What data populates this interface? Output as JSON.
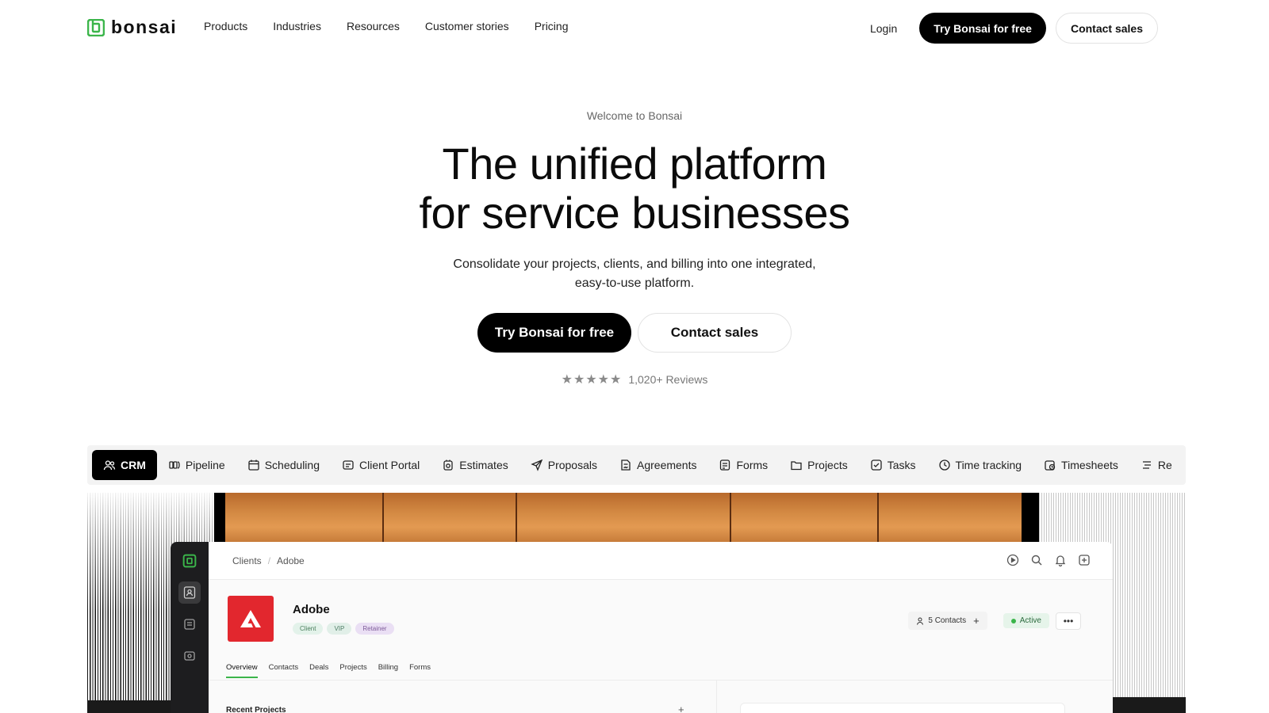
{
  "brand": {
    "name": "bonsai",
    "accent": "#3bb54a"
  },
  "nav": {
    "links": [
      "Products",
      "Industries",
      "Resources",
      "Customer stories",
      "Pricing"
    ],
    "login": "Login",
    "try_free": "Try Bonsai for free",
    "contact_sales": "Contact sales"
  },
  "hero": {
    "eyebrow": "Welcome to Bonsai",
    "headline_line1": "The unified platform",
    "headline_line2": "for service businesses",
    "subhead": "Consolidate your projects, clients, and billing into one integrated, easy-to-use platform.",
    "cta_primary": "Try Bonsai for free",
    "cta_secondary": "Contact sales",
    "stars": "★★★★★",
    "reviews": "1,020+ Reviews"
  },
  "feature_tabs": {
    "items": [
      {
        "label": "CRM",
        "icon": "users-icon",
        "active": true
      },
      {
        "label": "Pipeline",
        "icon": "pipeline-icon"
      },
      {
        "label": "Scheduling",
        "icon": "calendar-icon"
      },
      {
        "label": "Client Portal",
        "icon": "portal-icon"
      },
      {
        "label": "Estimates",
        "icon": "estimate-icon"
      },
      {
        "label": "Proposals",
        "icon": "send-icon"
      },
      {
        "label": "Agreements",
        "icon": "document-sign-icon"
      },
      {
        "label": "Forms",
        "icon": "form-icon"
      },
      {
        "label": "Projects",
        "icon": "folder-icon"
      },
      {
        "label": "Tasks",
        "icon": "checkbox-icon"
      },
      {
        "label": "Time tracking",
        "icon": "clock-icon"
      },
      {
        "label": "Timesheets",
        "icon": "timesheet-icon"
      },
      {
        "label": "Re",
        "icon": "report-icon"
      }
    ]
  },
  "app": {
    "breadcrumb": [
      "Clients",
      "Adobe"
    ],
    "client": {
      "name": "Adobe",
      "logo_color": "#e2272e",
      "chips": [
        "Client",
        "VIP",
        "Retainer"
      ],
      "contacts": "5 Contacts",
      "status": "Active"
    },
    "subtabs": [
      "Overview",
      "Contacts",
      "Deals",
      "Projects",
      "Billing",
      "Forms"
    ],
    "recent_projects_title": "Recent Projects"
  }
}
